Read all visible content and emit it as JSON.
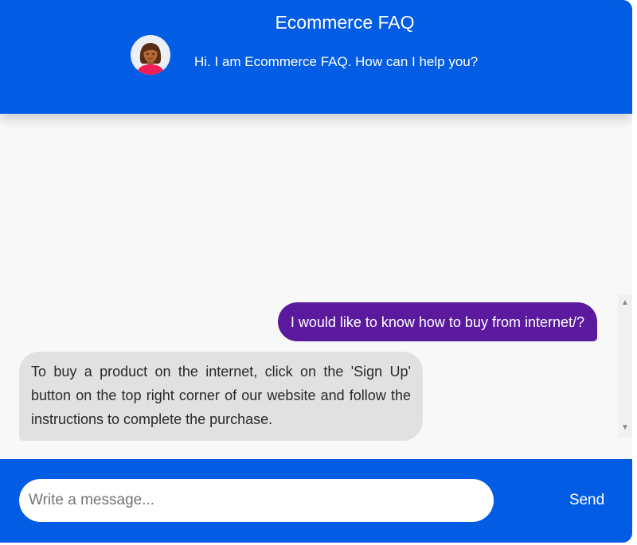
{
  "header": {
    "title": "Ecommerce FAQ",
    "subtitle": "Hi. I am Ecommerce FAQ. How can I help you?",
    "avatar_icon": "user-avatar-icon"
  },
  "messages": [
    {
      "from": "user",
      "text": "I would like to know how to buy from internet/?"
    },
    {
      "from": "bot",
      "text": "To buy a product on the internet, click on the 'Sign Up' button on the top right corner of our website and follow the instructions to complete the purchase."
    }
  ],
  "composer": {
    "placeholder": "Write a message...",
    "value": "",
    "send_label": "Send"
  },
  "colors": {
    "brand": "#025ce4",
    "user_bubble": "#5b1a9e",
    "bot_bubble": "#e1e1e1",
    "background": "#f8f8f8"
  }
}
